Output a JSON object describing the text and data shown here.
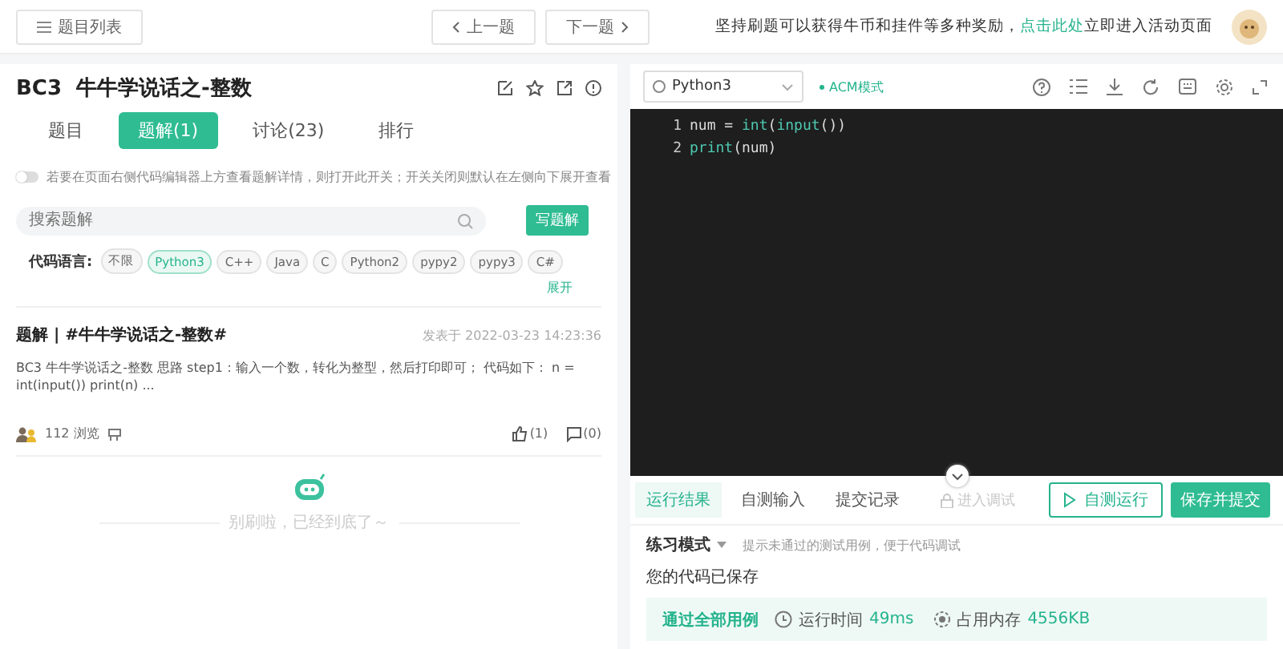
{
  "top_bar": {
    "problem_list_button": "题目列表",
    "prev_button": "上一题",
    "next_button": "下一题",
    "promo": {
      "text_before": "坚持刷题可以获得牛币和挂件等多种奖励，",
      "link": "点击此处",
      "text_after": "立即进入活动页面"
    }
  },
  "problem": {
    "title": "BC3  牛牛学说话之-整数",
    "tabs": [
      {
        "label": "题目",
        "selected": false
      },
      {
        "label": "题解(1)",
        "selected": true
      },
      {
        "label": "讨论(23)",
        "selected": false
      },
      {
        "label": "排行",
        "selected": false
      }
    ],
    "toggle": {
      "on": false,
      "text": "若要在页面右侧代码编辑器上方查看题解详情，则打开此开关；开关关闭则默认在左侧向下展开查看"
    },
    "search": {
      "placeholder": "搜索题解"
    },
    "write_button": "写题解",
    "language_filter": {
      "label": "代码语言:",
      "options": [
        {
          "label": "不限",
          "selected": false
        },
        {
          "label": "Python3",
          "selected": true
        },
        {
          "label": "C++",
          "selected": false
        },
        {
          "label": "Java",
          "selected": false
        },
        {
          "label": "C",
          "selected": false
        },
        {
          "label": "Python2",
          "selected": false
        },
        {
          "label": "pypy2",
          "selected": false
        },
        {
          "label": "pypy3",
          "selected": false
        },
        {
          "label": "C#",
          "selected": false
        }
      ],
      "expand": "展开"
    },
    "solution": {
      "title": "题解 | #牛牛学说话之-整数#",
      "date": "发表于 2022-03-23 14:23:36",
      "excerpt": "BC3 牛牛学说话之-整数 思路 step1：输入一个数，转化为整型，然后打印即可； 代码如下： n = int(input()) print(n) ...",
      "views": "112 浏览",
      "likes": "(1)",
      "comments": "(0)"
    },
    "end_message": "别刷啦，已经到底了～"
  },
  "editor": {
    "language": "Python3",
    "mode": "ACM模式",
    "lines": [
      {
        "number": "1",
        "tokens": [
          {
            "text": "num = ",
            "kind": "plain"
          },
          {
            "text": "int",
            "kind": "builtin"
          },
          {
            "text": "(",
            "kind": "plain"
          },
          {
            "text": "input",
            "kind": "builtin"
          },
          {
            "text": "())",
            "kind": "plain"
          }
        ]
      },
      {
        "number": "2",
        "tokens": [
          {
            "text": "print",
            "kind": "builtin"
          },
          {
            "text": "(num)",
            "kind": "plain"
          }
        ]
      }
    ]
  },
  "result": {
    "tabs": [
      {
        "label": "运行结果",
        "selected": true
      },
      {
        "label": "自测输入",
        "selected": false
      },
      {
        "label": "提交记录",
        "selected": false
      }
    ],
    "debug_button": {
      "label": "进入调试",
      "disabled": true
    },
    "run_button": "自测运行",
    "submit_button": "保存并提交",
    "mode": "练习模式",
    "mode_hint": "提示未通过的测试用例，便于代码调试",
    "saved": "您的代码已保存",
    "status": "通过全部用例",
    "runtime_label": "运行时间",
    "runtime": "49ms",
    "memory_label": "占用内存",
    "memory": "4556KB"
  }
}
